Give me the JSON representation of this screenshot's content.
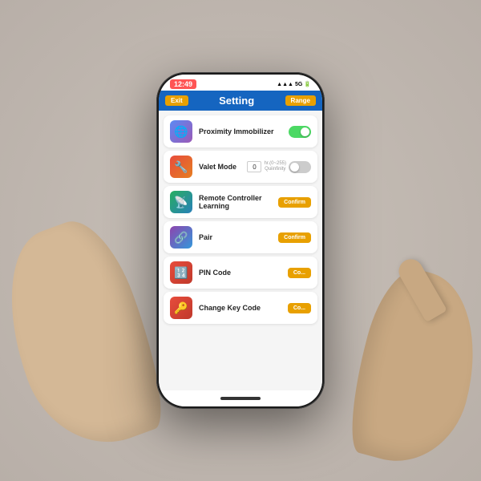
{
  "scene": {
    "bg_color": "#c8c0b8"
  },
  "status_bar": {
    "time": "12:49",
    "signal": "5G",
    "battery": "■"
  },
  "header": {
    "exit_label": "Exit",
    "title": "Setting",
    "range_label": "Range"
  },
  "settings": [
    {
      "id": "proximity",
      "icon": "🌐",
      "icon_class": "icon-proximity",
      "label": "Proximity Immobilizer",
      "action_type": "toggle",
      "toggle_on": true
    },
    {
      "id": "valet",
      "icon": "🔧",
      "icon_class": "icon-valet",
      "label": "Valet Mode",
      "action_type": "valet",
      "valet_value": "0",
      "valet_hint": "hr.(0~255)\nQuiinfinity",
      "toggle_on": false
    },
    {
      "id": "remote",
      "icon": "📡",
      "icon_class": "icon-remote",
      "label": "Remote Controller Learning",
      "action_type": "confirm",
      "confirm_label": "Confirm"
    },
    {
      "id": "pair",
      "icon": "🔗",
      "icon_class": "icon-pair",
      "label": "Pair",
      "action_type": "confirm",
      "confirm_label": "Confirm"
    },
    {
      "id": "pin",
      "icon": "🔢",
      "icon_class": "icon-pin",
      "label": "PIN Code",
      "action_type": "confirm",
      "confirm_label": "Co..."
    },
    {
      "id": "change",
      "icon": "🔑",
      "icon_class": "icon-change",
      "label": "Change Key Code",
      "action_type": "confirm",
      "confirm_label": "Co..."
    }
  ]
}
